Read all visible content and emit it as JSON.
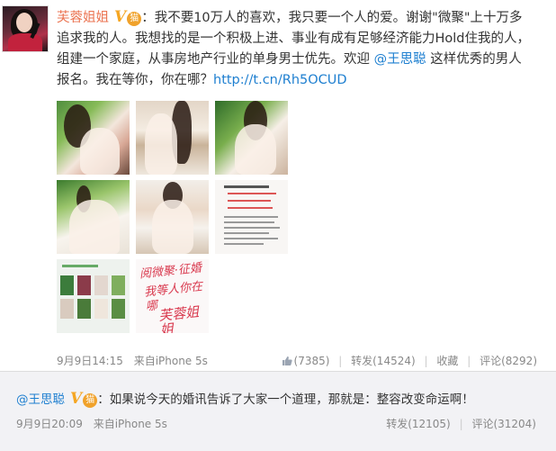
{
  "post": {
    "author": "芙蓉姐姐",
    "verified_badge": "V",
    "club_badge": "🐱",
    "text_line1": "：我不要10万人的喜欢，我只要一个人的爱。谢谢\"微聚\"上十万多",
    "text_line2": "追求我的人。我想找的是一个积极上进、事业有成有足够经济能力Hold住我的人，",
    "text_line3": "组建一个家庭，从事房地产行业的单身男士优先。欢迎 ",
    "mention": "@王思聪",
    "text_line3b": " 这样优秀的男人",
    "text_line4": "报名。我在等你，你在哪？",
    "link": "http://t.cn/Rh5OCUD",
    "calligraphy": [
      "阅微聚·征婚",
      "我等人你在哪",
      "芙蓉姐姐"
    ],
    "time": "9月9日14:15",
    "source": "来自iPhone 5s",
    "like_count": "(7385)",
    "repost": "转发(14524)",
    "favorite": "收藏",
    "comment": "评论(8292)"
  },
  "repost": {
    "author": "@王思聪",
    "verified_badge": "V",
    "club_badge": "🐱",
    "text": "：如果说今天的婚讯告诉了大家一个道理，那就是：整容改变命运啊！",
    "time": "9月9日20:09",
    "source": "来自iPhone 5s",
    "repost": "转发(12105)",
    "comment": "评论(31204)"
  },
  "colors": {
    "name": "#eb7350",
    "link": "#1e7fd0",
    "meta": "#888888",
    "panel_bg": "#f2f2f5"
  },
  "icons": [
    "avatar",
    "verified-v-icon",
    "member-badge-icon",
    "thumbs-up-icon"
  ]
}
